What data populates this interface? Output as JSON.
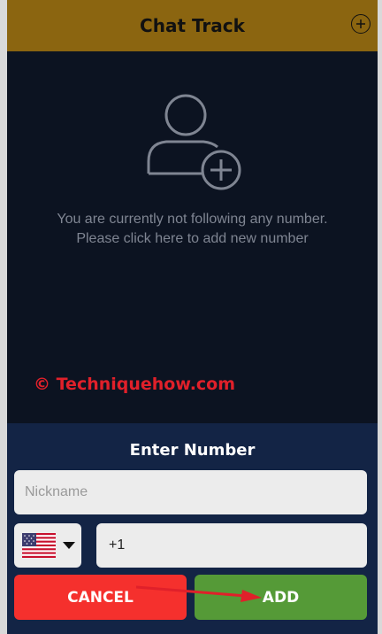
{
  "header": {
    "title": "Chat Track",
    "add_icon": "plus-circle-icon"
  },
  "empty_state": {
    "icon": "add-user-icon",
    "line1": "You are currently not following any number.",
    "line2": "Please click here to add new number"
  },
  "watermark": "© Techniquehow.com",
  "dialog": {
    "title": "Enter Number",
    "nickname_placeholder": "Nickname",
    "nickname_value": "",
    "country_flag": "us-flag-icon",
    "phone_value": "+1",
    "cancel_label": "CANCEL",
    "add_label": "ADD"
  },
  "colors": {
    "header": "#8b6510",
    "background": "#0c1321",
    "dialog": "#132445",
    "cancel": "#f5302d",
    "add": "#559a37",
    "annotation": "#e0202a"
  }
}
